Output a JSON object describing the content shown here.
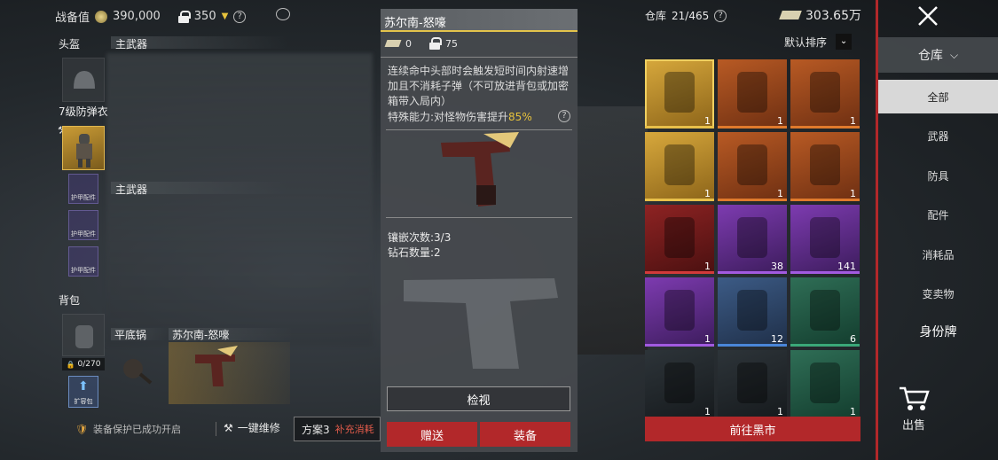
{
  "topbar": {
    "combat_label": "战备值",
    "combat_value": "390,000",
    "lock_value": "350",
    "help": "?"
  },
  "loadout": {
    "helmet_label": "头盔",
    "primary1_label": "主武器",
    "armor_label": "7级防弹衣",
    "primary2_label": "主武器",
    "armor_parts": [
      "护甲配件",
      "护甲配件",
      "护甲配件"
    ],
    "backpack_label": "背包",
    "backpack_capacity": "0/270",
    "backpack_btn": "扩容包",
    "melee_label": "平底锅",
    "sidearm_label": "苏尔南-怒嚎"
  },
  "bottombar": {
    "protection_text": "装备保护已成功开启",
    "repair_label": "一键维修",
    "plan_label": "方案3",
    "supply_label": "补充消耗"
  },
  "detail": {
    "title": "苏尔南-怒嚎",
    "stat1": "0",
    "stat2": "75",
    "desc": "连续命中头部时会触发短时间内射速增加且不消耗子弹（不可放进背包或加密箱带入局内）",
    "special_prefix": "特殊能力:对怪物伤害提升",
    "special_value": "85%",
    "inlay_count": "镶嵌次数:3/3",
    "diamond_count": "钻石数量:2",
    "inspect_btn": "检视",
    "gift_btn": "赠送",
    "equip_btn": "装备"
  },
  "storage": {
    "label": "仓库",
    "count": "21/465",
    "money": "303.65万",
    "sort_label": "默认排序",
    "goto_btn": "前往黑市",
    "items": [
      {
        "name": "pistol-item",
        "count": "1",
        "color": "gold"
      },
      {
        "name": "helmet-item",
        "count": "1",
        "color": "orange"
      },
      {
        "name": "armor-suit-item",
        "count": "1",
        "color": "orange"
      },
      {
        "name": "vest-item",
        "count": "1",
        "color": "gold"
      },
      {
        "name": "backpack-item",
        "count": "1",
        "color": "orange"
      },
      {
        "name": "armor-vest-item",
        "count": "1",
        "color": "orange"
      },
      {
        "name": "red-backpack-item",
        "count": "1",
        "color": "red"
      },
      {
        "name": "ammo-box-item",
        "count": "38",
        "color": "purple"
      },
      {
        "name": "ammo-box-green-item",
        "count": "141",
        "color": "purple"
      },
      {
        "name": "case-item",
        "count": "1",
        "color": "purple"
      },
      {
        "name": "medkit-box-item",
        "count": "12",
        "color": "blue"
      },
      {
        "name": "container-item",
        "count": "6",
        "color": "green"
      },
      {
        "name": "syringe-item",
        "count": "1",
        "color": "dark"
      },
      {
        "name": "rig-item",
        "count": "1",
        "color": "dark"
      },
      {
        "name": "artifact-item",
        "count": "1",
        "color": "green"
      }
    ]
  },
  "sidebar": {
    "warehouse_tab": "仓库",
    "items": [
      "全部",
      "武器",
      "防具",
      "配件",
      "消耗品",
      "变卖物",
      "身份牌"
    ],
    "sell_label": "出售"
  }
}
